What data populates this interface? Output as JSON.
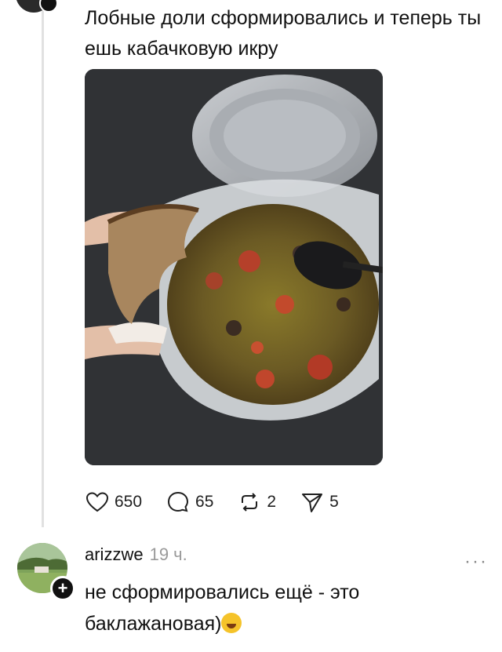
{
  "post": {
    "text": "Лобные доли сформировались и теперь ты ешь кабачковую икру",
    "image_alt": "Хлебный сухарь над контейнером с овощной икрой",
    "actions": {
      "likes": "650",
      "comments": "65",
      "reposts": "2",
      "shares": "5"
    }
  },
  "reply": {
    "username": "arizzwe",
    "time": "19 ч.",
    "text": "не сформировались ещё - это баклажановая)",
    "more_label": "···"
  },
  "colors": {
    "thread_line": "#e1e1e1",
    "muted_text": "#9a9a9a",
    "icon_stroke": "#1f1f1f"
  },
  "icons": [
    "heart-icon",
    "comment-icon",
    "repost-icon",
    "share-icon",
    "more-icon",
    "follow-plus-icon",
    "laughing-emoji-icon"
  ]
}
